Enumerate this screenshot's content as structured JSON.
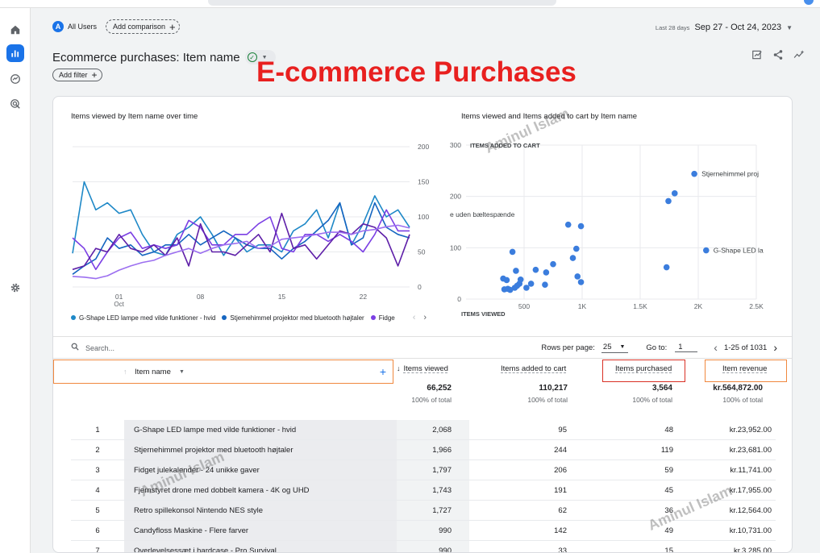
{
  "segment": {
    "badge": "A",
    "label": "All Users",
    "compare_label": "Add comparison"
  },
  "date_range": {
    "label": "Last 28 days",
    "value": "Sep 27 - Oct 24, 2023"
  },
  "report": {
    "title": "Ecommerce purchases: Item name",
    "add_filter": "Add filter"
  },
  "overlay_title": "E-commerce Purchases",
  "watermarks": [
    "Aminul Islam",
    "Aminul Islam",
    "Aminul Islam"
  ],
  "chart_line": {
    "title": "Items viewed by Item name over time",
    "y_ticks": [
      "200",
      "150",
      "100",
      "50",
      "0"
    ],
    "x_ticks": [
      "01",
      "08",
      "15",
      "22"
    ],
    "x_sub": "Oct"
  },
  "chart_scatter": {
    "title": "Items viewed and Items added to cart by Item name",
    "y_label": "ITEMS ADDED TO CART",
    "x_label": "ITEMS VIEWED",
    "y_ticks": [
      "300",
      "200",
      "100",
      "0"
    ],
    "x_ticks": [
      "500",
      "1K",
      "1.5K",
      "2K",
      "2.5K"
    ],
    "annotations": [
      "Stjernehimmel proj",
      "e uden bæltespænde",
      "G-Shape LED la"
    ]
  },
  "legend": [
    {
      "label": "G-Shape LED lampe med vilde funktioner - hvid",
      "color": "#1e88c7"
    },
    {
      "label": "Stjernehimmel projektor med bluetooth højtaler",
      "color": "#1565c0"
    },
    {
      "label": "Fidge",
      "color": "#7b3fe4"
    }
  ],
  "table_tools": {
    "search_placeholder": "Search...",
    "rows_label": "Rows per page:",
    "rows_value": "25",
    "goto_label": "Go to:",
    "goto_value": "1",
    "range": "1-25 of 1031"
  },
  "columns": {
    "item": "Item name",
    "viewed": "Items viewed",
    "cart": "Items added to cart",
    "purchased": "Items purchased",
    "revenue": "Item revenue"
  },
  "totals": {
    "viewed": "66,252",
    "viewed_pct": "100% of total",
    "cart": "110,217",
    "cart_pct": "100% of total",
    "purchased": "3,564",
    "purchased_pct": "100% of total",
    "revenue": "kr.564,872.00",
    "revenue_pct": "100% of total"
  },
  "rows": [
    {
      "idx": "1",
      "name": "G-Shape LED lampe med vilde funktioner - hvid",
      "viewed": "2,068",
      "cart": "95",
      "purchased": "48",
      "revenue": "kr.23,952.00"
    },
    {
      "idx": "2",
      "name": "Stjernehimmel projektor med bluetooth højtaler",
      "viewed": "1,966",
      "cart": "244",
      "purchased": "119",
      "revenue": "kr.23,681.00"
    },
    {
      "idx": "3",
      "name": "Fidget julekalender - 24 unikke gaver",
      "viewed": "1,797",
      "cart": "206",
      "purchased": "59",
      "revenue": "kr.11,741.00"
    },
    {
      "idx": "4",
      "name": "Fjernstyret drone med dobbelt kamera - 4K og UHD",
      "viewed": "1,743",
      "cart": "191",
      "purchased": "45",
      "revenue": "kr.17,955.00"
    },
    {
      "idx": "5",
      "name": "Retro spillekonsol Nintendo NES style",
      "viewed": "1,727",
      "cart": "62",
      "purchased": "36",
      "revenue": "kr.12,564.00"
    },
    {
      "idx": "6",
      "name": "Candyfloss Maskine - Flere farver",
      "viewed": "990",
      "cart": "142",
      "purchased": "49",
      "revenue": "kr.10,731.00"
    },
    {
      "idx": "7",
      "name": "Overlevelsessæt i hardcase - Pro Survival",
      "viewed": "990",
      "cart": "33",
      "purchased": "15",
      "revenue": "kr.3,285.00"
    }
  ],
  "line_series": [
    {
      "color": "#1e88c7",
      "values": [
        48,
        150,
        110,
        120,
        105,
        110,
        75,
        50,
        45,
        75,
        85,
        100,
        75,
        45,
        70,
        50,
        60,
        60,
        50,
        80,
        90,
        110,
        70,
        120,
        60,
        90,
        130,
        100,
        110,
        85
      ]
    },
    {
      "color": "#1565c0",
      "values": [
        18,
        30,
        40,
        70,
        55,
        60,
        45,
        50,
        60,
        60,
        75,
        60,
        70,
        80,
        70,
        60,
        55,
        55,
        40,
        55,
        65,
        80,
        95,
        120,
        60,
        70,
        120,
        85,
        75,
        70
      ]
    },
    {
      "color": "#7b3fe4",
      "values": [
        70,
        55,
        25,
        50,
        70,
        78,
        55,
        60,
        55,
        60,
        95,
        85,
        60,
        60,
        75,
        75,
        90,
        100,
        55,
        50,
        75,
        75,
        65,
        75,
        65,
        50,
        75,
        110,
        80,
        80
      ]
    },
    {
      "color": "#5e1fa8",
      "values": [
        25,
        30,
        55,
        50,
        75,
        55,
        50,
        60,
        45,
        70,
        30,
        90,
        50,
        50,
        45,
        60,
        75,
        50,
        105,
        55,
        60,
        40,
        60,
        80,
        75,
        90,
        85,
        70,
        30,
        75
      ]
    },
    {
      "color": "#9c6ff0",
      "values": [
        15,
        14,
        12,
        16,
        24,
        30,
        35,
        38,
        45,
        50,
        55,
        48,
        55,
        60,
        62,
        65,
        55,
        58,
        68,
        70,
        72,
        75,
        78,
        78,
        75,
        80,
        82,
        86,
        88,
        84
      ]
    }
  ],
  "scatter_points": [
    [
      2068,
      95
    ],
    [
      1966,
      244
    ],
    [
      1797,
      206
    ],
    [
      1743,
      191
    ],
    [
      1727,
      62
    ],
    [
      990,
      142
    ],
    [
      990,
      33
    ],
    [
      400,
      92
    ],
    [
      430,
      55
    ],
    [
      880,
      145
    ],
    [
      920,
      80
    ],
    [
      950,
      98
    ],
    [
      960,
      44
    ],
    [
      320,
      40
    ],
    [
      350,
      37
    ],
    [
      420,
      22
    ],
    [
      380,
      18
    ],
    [
      460,
      30
    ],
    [
      470,
      38
    ],
    [
      560,
      30
    ],
    [
      600,
      57
    ],
    [
      520,
      22
    ],
    [
      330,
      19
    ],
    [
      360,
      20
    ],
    [
      440,
      26
    ],
    [
      680,
      28
    ],
    [
      750,
      68
    ],
    [
      690,
      52
    ]
  ]
}
